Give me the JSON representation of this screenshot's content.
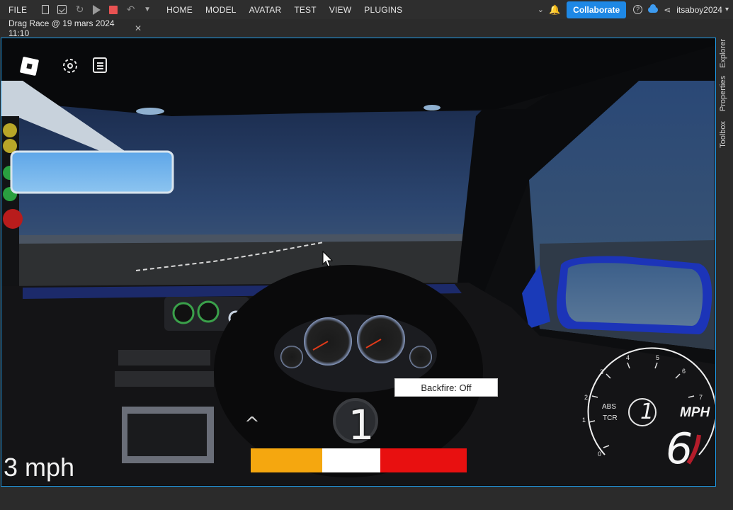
{
  "menubar": {
    "file_label": "FILE",
    "tabs": [
      "HOME",
      "MODEL",
      "AVATAR",
      "TEST",
      "VIEW",
      "PLUGINS"
    ],
    "collaborate_label": "Collaborate",
    "username": "itsaboy2024"
  },
  "document_tab": {
    "title": "Drag Race @ 19 mars 2024 11:10",
    "close_glyph": "✕"
  },
  "right_dock": {
    "items": [
      "Explorer",
      "Properties",
      "Toolbox"
    ]
  },
  "game_hud": {
    "speed_text": "3 mph",
    "backfire_label": "Backfire: Off",
    "gear": "1",
    "shift_indicator": "^",
    "rev_bar_segments": [
      {
        "fraction": 0.33,
        "color": "#f5a70f"
      },
      {
        "fraction": 0.27,
        "color": "#ffffff"
      },
      {
        "fraction": 0.4,
        "color": "#e81010"
      }
    ],
    "speedometer": {
      "unit": "MPH",
      "value": "6",
      "gear": "1",
      "abs_label": "ABS",
      "tcr_label": "TCR",
      "ticks": [
        "0",
        "1",
        "2",
        "3",
        "4",
        "5",
        "6",
        "7"
      ]
    }
  },
  "colors": {
    "accent": "#1e88e5",
    "viewport_border": "#1e9be8",
    "stop_red": "#e85252"
  }
}
